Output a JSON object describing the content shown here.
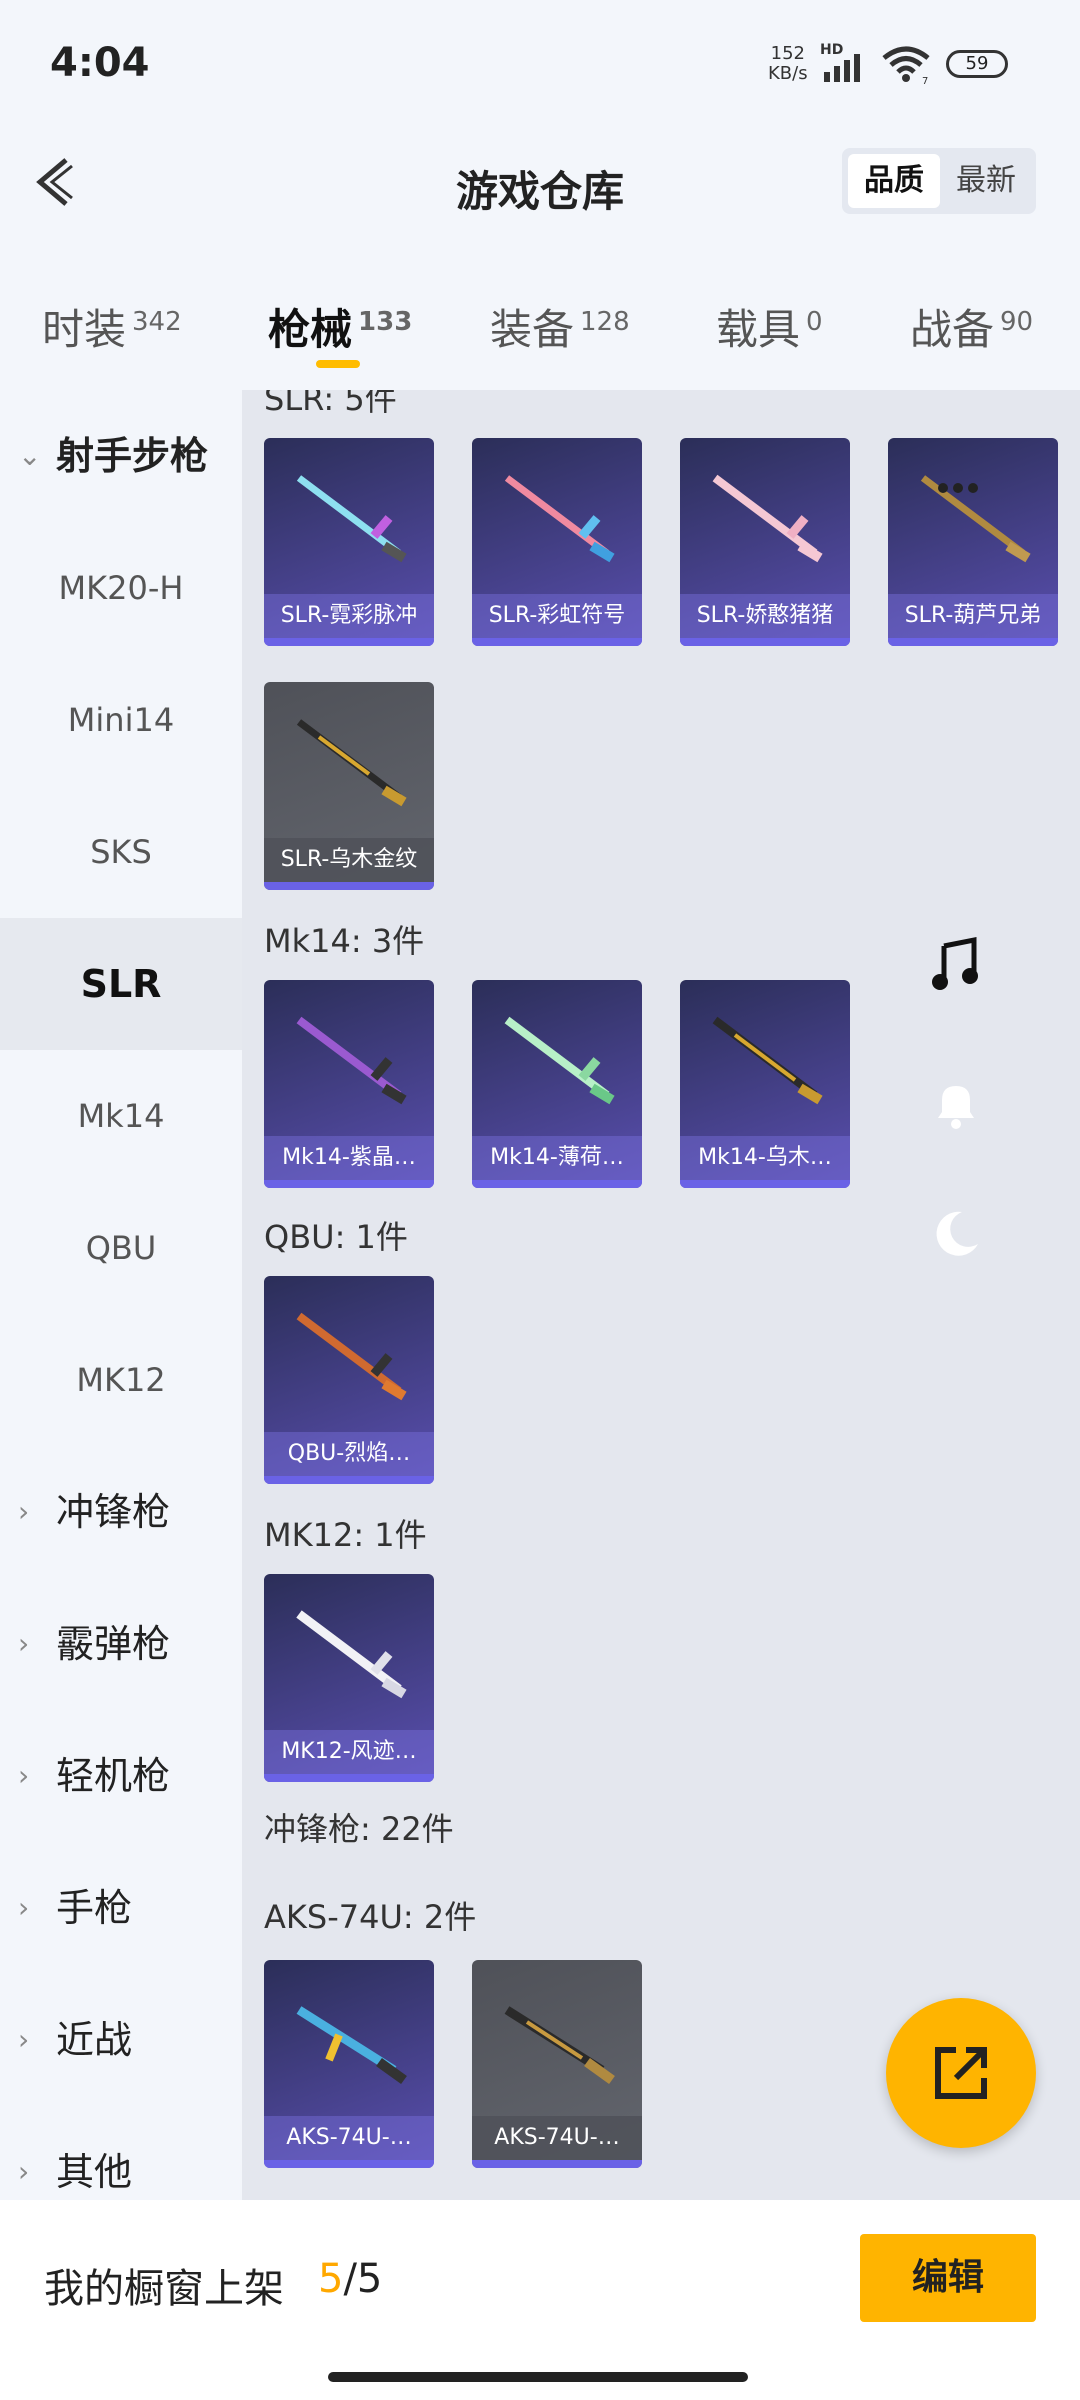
{
  "status": {
    "time": "4:04",
    "net_value": "152",
    "net_unit": "KB/s",
    "hd": "HD",
    "wifi_num": "7",
    "battery": "59"
  },
  "header": {
    "title": "游戏仓库",
    "sort_quality": "品质",
    "sort_latest": "最新"
  },
  "tabs": [
    {
      "label": "时装",
      "count": "342"
    },
    {
      "label": "枪械",
      "count": "133"
    },
    {
      "label": "装备",
      "count": "128"
    },
    {
      "label": "载具",
      "count": "0"
    },
    {
      "label": "战备",
      "count": "90"
    }
  ],
  "sidebar": {
    "cat_rifle": "射手步枪",
    "items": [
      "MK20-H",
      "Mini14",
      "SKS",
      "SLR",
      "Mk14",
      "QBU",
      "MK12"
    ],
    "cats": [
      "冲锋枪",
      "霰弹枪",
      "轻机枪",
      "手枪",
      "近战",
      "其他"
    ]
  },
  "groups": {
    "slr": "SLR: 5件",
    "mk14": "Mk14: 3件",
    "qbu": "QBU: 1件",
    "mk12": "MK12: 1件",
    "smg": "冲锋枪: 22件",
    "aks": "AKS-74U: 2件"
  },
  "cards": {
    "slr": [
      "SLR-霓彩脉冲",
      "SLR-彩虹符号",
      "SLR-娇憨猪猪",
      "SLR-葫芦兄弟",
      "SLR-乌木金纹"
    ],
    "mk14": [
      "Mk14-紫晶…",
      "Mk14-薄荷…",
      "Mk14-乌木…"
    ],
    "qbu": [
      "QBU-烈焰…"
    ],
    "mk12": [
      "MK12-风迹…"
    ],
    "aks": [
      "AKS-74U-…",
      "AKS-74U-…"
    ]
  },
  "bottom": {
    "label": "我的橱窗上架",
    "count_current": "5",
    "count_total": "/5",
    "edit": "编辑"
  },
  "colors": {
    "accent": "#ffb400",
    "card_purple": "#5a4fb0",
    "card_gray": "#5a5c63"
  }
}
